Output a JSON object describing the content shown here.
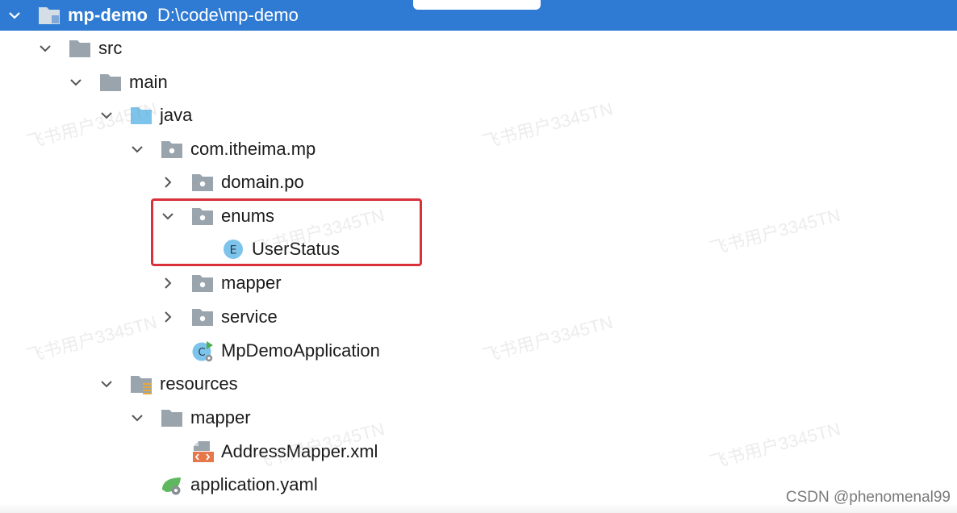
{
  "project": {
    "name": "mp-demo",
    "path": "D:\\code\\mp-demo"
  },
  "tree": [
    {
      "label": "src"
    },
    {
      "label": "main"
    },
    {
      "label": "java"
    },
    {
      "label": "com.itheima.mp"
    },
    {
      "label": "domain.po"
    },
    {
      "label": "enums"
    },
    {
      "label": "UserStatus"
    },
    {
      "label": "mapper"
    },
    {
      "label": "service"
    },
    {
      "label": "MpDemoApplication"
    },
    {
      "label": "resources"
    },
    {
      "label": "mapper"
    },
    {
      "label": "AddressMapper.xml"
    },
    {
      "label": "application.yaml"
    }
  ],
  "watermark_text": "飞书用户3345TN",
  "credit": "CSDN @phenomenal99",
  "colors": {
    "selection": "#2f7bd3",
    "highlight": "#d9303b",
    "folder_gray": "#9aa4ad",
    "source_folder": "#7cc4ec"
  }
}
